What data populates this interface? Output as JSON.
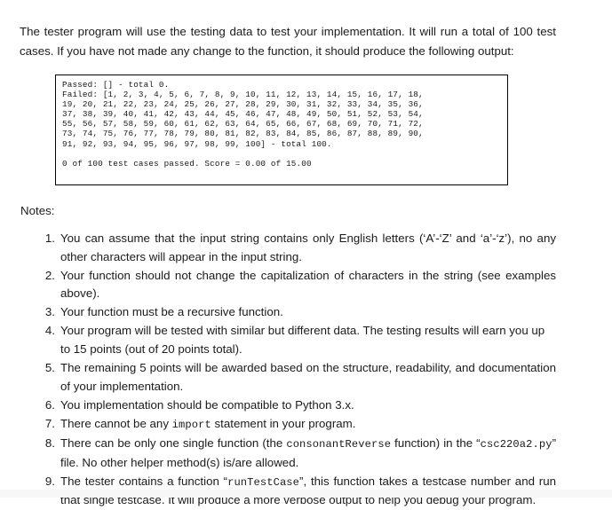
{
  "document": {
    "intro_paragraph": "The tester program will use the testing data to test your implementation. It will run a total of 100 test cases. If you have not made any change to the function, it should produce the following output:",
    "console_output": "Passed: [] - total 0.\nFailed: [1, 2, 3, 4, 5, 6, 7, 8, 9, 10, 11, 12, 13, 14, 15, 16, 17, 18,\n19, 20, 21, 22, 23, 24, 25, 26, 27, 28, 29, 30, 31, 32, 33, 34, 35, 36,\n37, 38, 39, 40, 41, 42, 43, 44, 45, 46, 47, 48, 49, 50, 51, 52, 53, 54,\n55, 56, 57, 58, 59, 60, 61, 62, 63, 64, 65, 66, 67, 68, 69, 70, 71, 72,\n73, 74, 75, 76, 77, 78, 79, 80, 81, 82, 83, 84, 85, 86, 87, 88, 89, 90,\n91, 92, 93, 94, 95, 96, 97, 98, 99, 100] - total 100.\n\n0 of 100 test cases passed. Score = 0.00 of 15.00",
    "notes_label": "Notes:",
    "notes": [
      {
        "number": "1.",
        "text": "You can assume that the input string contains only English letters (‘A’-‘Z’ and ‘a’-‘z’), no any other characters will appear in the input string."
      },
      {
        "number": "2.",
        "text": "Your function should not change the capitalization of characters in the string (see examples above)."
      },
      {
        "number": "3.",
        "text": "Your function must be a recursive function."
      },
      {
        "number": "4.",
        "text": "Your program will be tested with similar but different data. The testing results will earn you up to 15 points (out of 20 points total)."
      },
      {
        "number": "5.",
        "text": "The remaining 5 points will be awarded based on the structure, readability, and documentation of your implementation."
      },
      {
        "number": "6.",
        "text": "You implementation should be compatible to Python 3.x."
      },
      {
        "number": "7.",
        "text_before": "There cannot be any ",
        "mono": "import",
        "text_after": " statement in your program."
      },
      {
        "number": "8.",
        "text_before": "There can be only one single function (the ",
        "mono": "consonantReverse",
        "text_mid": " function) in the “",
        "mono2": "csc220a2.py",
        "text_after": "” file. No other helper method(s) is/are allowed."
      },
      {
        "number": "9.",
        "text_before": "The tester contains a function “",
        "mono": "runTestCase",
        "text_after": "”, this function takes a testcase number and run that single testcase. It will produce a more verbose output to help you debug your program."
      }
    ]
  }
}
